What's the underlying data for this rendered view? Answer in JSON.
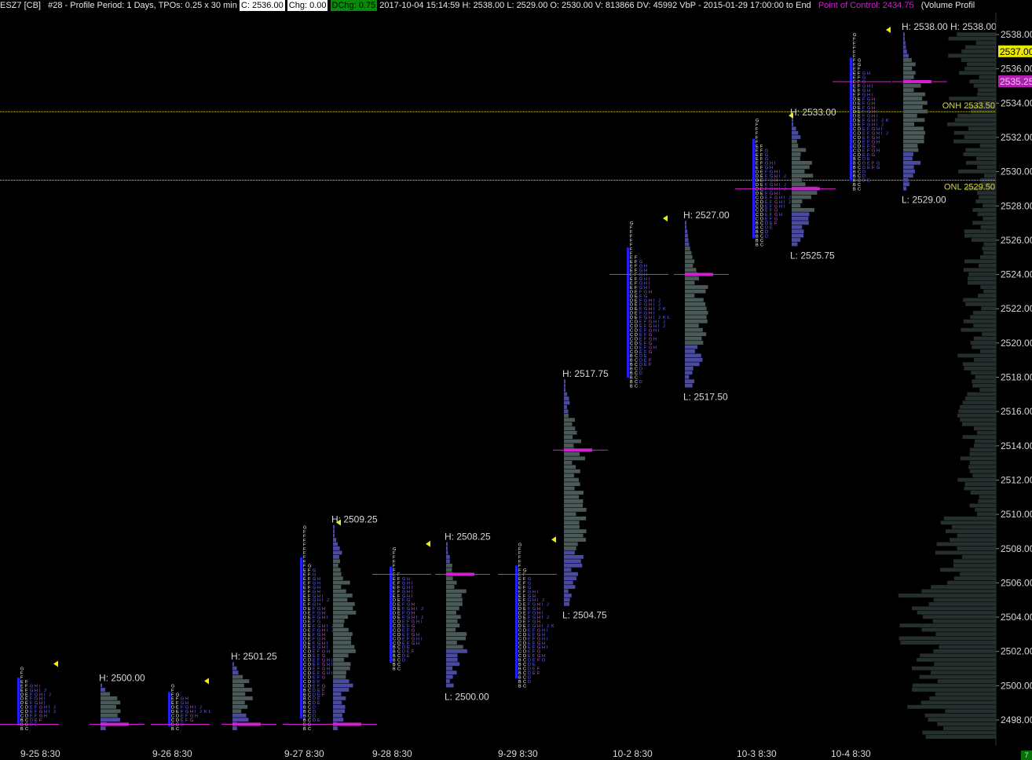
{
  "header": {
    "symbol": "ESZ7 [CB]",
    "info": "#28 - Profile Period: 1 Days, TPOs: 0.25 x 30 min",
    "close": "C: 2536.00",
    "change": "Chg: 0.00",
    "dchange": "DChg: 0.75",
    "stats": "2017-10-04 15:14:59 H: 2538.00 L: 2529.00 O: 2530.00 V: 813866 DV: 45992 VbP - 2015-01-29  17:00:00 to End",
    "poc": "Point of Control: 2434.75",
    "study": "(Volume Profil"
  },
  "colors": {
    "background": "#000000",
    "tpo_early": "#ffffff",
    "tpo_late": "#6a6aff",
    "tpo_mid": "#c060c0",
    "volume_bar": "#4a5a58",
    "volume_bar_late": "#4a4aa0",
    "poc": "#d020d0",
    "value_area": "#2020ff",
    "overnight_line": "#d8d840",
    "current_price_bg": "#e8e800",
    "poc_price_bg": "#b020b0"
  },
  "price_axis": {
    "ticks": [
      "2538.00",
      "2536.00",
      "2534.00",
      "2532.00",
      "2530.00",
      "2528.00",
      "2526.00",
      "2524.00",
      "2522.00",
      "2520.00",
      "2518.00",
      "2516.00",
      "2514.00",
      "2512.00",
      "2510.00",
      "2508.00",
      "2506.00",
      "2504.00",
      "2502.00",
      "2500.00",
      "2498.00"
    ],
    "current_price": "2537.00",
    "poc_price": "2535.25"
  },
  "overnight": {
    "onh_label": "ONH  2533.50",
    "onl_label": "ONL  2529.50",
    "onh": 2533.5,
    "onl": 2529.5
  },
  "date_axis": [
    "9-25  8:30",
    "9-26  8:30",
    "9-27  8:30",
    "9-28  8:30",
    "9-29  8:30",
    "10-2  8:30",
    "10-3  8:30",
    "10-4  8:30"
  ],
  "sessions": [
    {
      "high_label": "",
      "low_label": "",
      "high": 2501.0,
      "low": 2497.5,
      "poc": 2497.75
    },
    {
      "high_label": "H: 2500.00",
      "low_label": "",
      "high": 2500.0,
      "low": 2497.5,
      "poc": 2497.75
    },
    {
      "high_label": "H: 2501.25",
      "low_label": "",
      "high": 2501.25,
      "low": 2497.5,
      "poc": 2497.75
    },
    {
      "high_label": "H: 2509.25",
      "low_label": "",
      "high": 2509.25,
      "low": 2497.5,
      "poc": 2497.75
    },
    {
      "high_label": "",
      "low_label": "",
      "high": 2508.0,
      "low": 2501.0,
      "poc": 2506.5
    },
    {
      "high_label": "H: 2508.25",
      "low_label": "L: 2500.00",
      "high": 2508.25,
      "low": 2500.0,
      "poc": 2506.5
    },
    {
      "high_label": "H: 2517.75",
      "low_label": "L: 2504.75",
      "high": 2517.75,
      "low": 2504.75,
      "poc": 2513.75
    },
    {
      "high_label": "H: 2527.00",
      "low_label": "L: 2517.50",
      "high": 2527.0,
      "low": 2517.5,
      "poc": 2524.0
    },
    {
      "high_label": "H: 2533.00",
      "low_label": "L: 2525.75",
      "high": 2533.0,
      "low": 2525.75,
      "poc": 2529.0
    },
    {
      "high_label": "H: 2538.00",
      "low_label": "L: 2529.00",
      "high": 2538.0,
      "low": 2529.0,
      "poc": 2535.25
    }
  ],
  "current_high_label": "H: 2538.00",
  "corner_badge": "7"
}
